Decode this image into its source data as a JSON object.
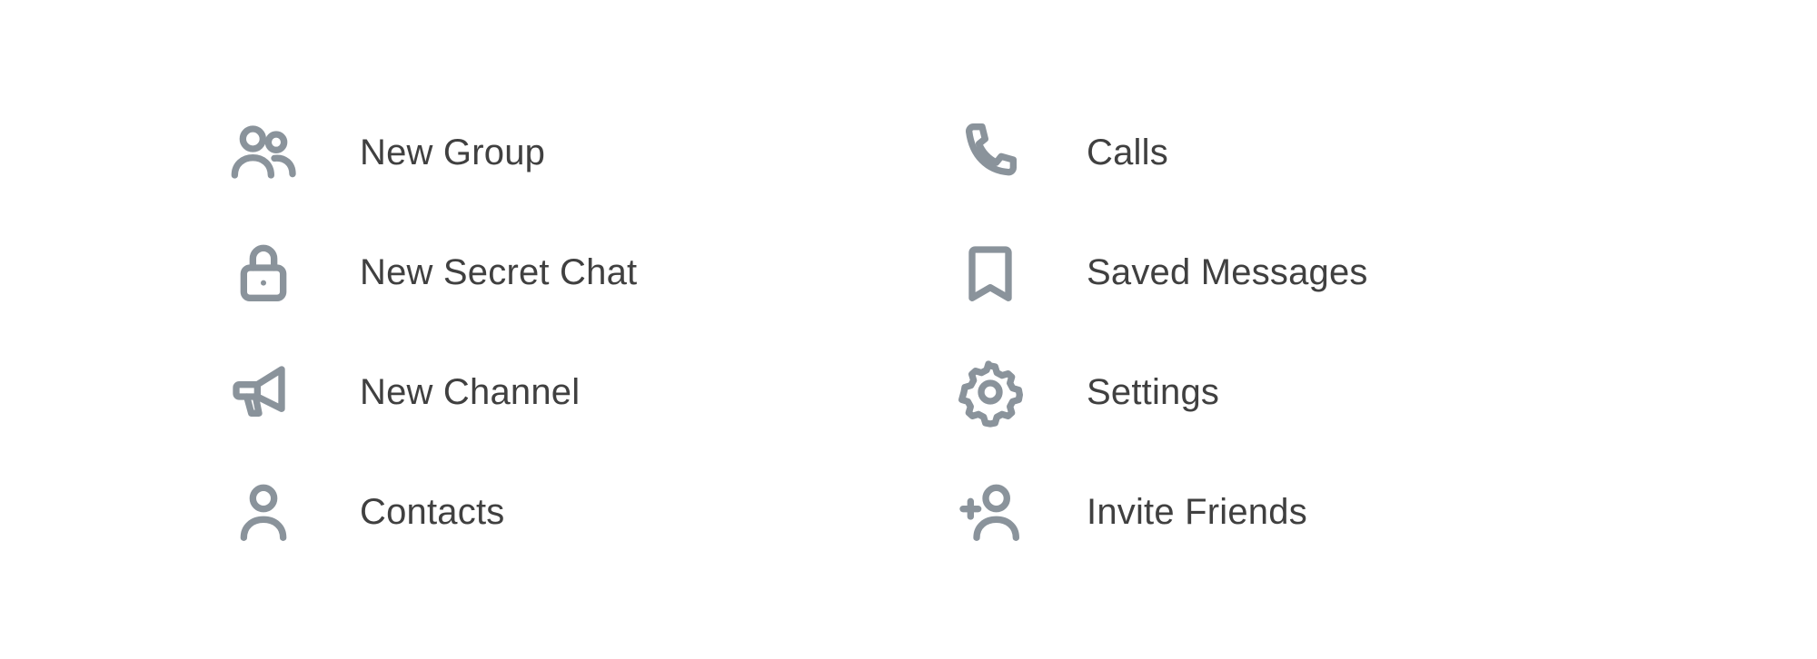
{
  "theme": {
    "icon_color": "#8a939b",
    "text_color": "#404040",
    "background": "#ffffff"
  },
  "menu": {
    "left": [
      {
        "label": "New Group",
        "icon": "group-icon"
      },
      {
        "label": "New Secret Chat",
        "icon": "lock-icon"
      },
      {
        "label": "New Channel",
        "icon": "megaphone-icon"
      },
      {
        "label": "Contacts",
        "icon": "user-icon"
      }
    ],
    "right": [
      {
        "label": "Calls",
        "icon": "phone-icon"
      },
      {
        "label": "Saved Messages",
        "icon": "bookmark-icon"
      },
      {
        "label": "Settings",
        "icon": "gear-icon"
      },
      {
        "label": "Invite Friends",
        "icon": "add-user-icon"
      }
    ]
  }
}
